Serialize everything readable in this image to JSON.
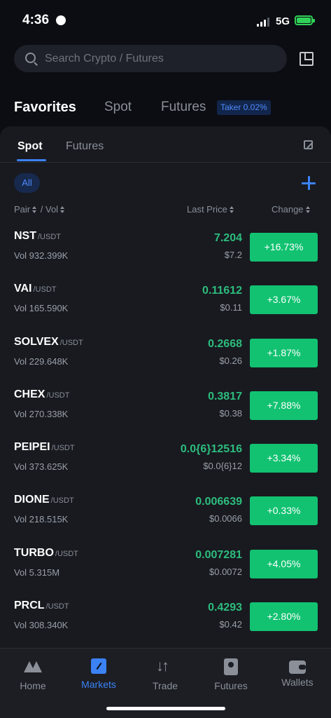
{
  "status_bar": {
    "time": "4:36",
    "network": "5G"
  },
  "search": {
    "placeholder": "Search Crypto / Futures"
  },
  "top_tabs": [
    {
      "label": "Favorites",
      "active": true
    },
    {
      "label": "Spot",
      "active": false
    },
    {
      "label": "Futures",
      "active": false
    }
  ],
  "taker_badge": "Taker 0.02%",
  "sub_tabs": [
    {
      "label": "Spot",
      "active": true
    },
    {
      "label": "Futures",
      "active": false
    }
  ],
  "filter": {
    "label": "All"
  },
  "columns": {
    "pair": "Pair",
    "vol": "Vol",
    "last_price": "Last Price",
    "change": "Change"
  },
  "rows": [
    {
      "base": "NST",
      "quote": "/USDT",
      "vol": "Vol 932.399K",
      "price": "7.204",
      "fiat": "$7.2",
      "change": "+16.73%"
    },
    {
      "base": "VAI",
      "quote": "/USDT",
      "vol": "Vol 165.590K",
      "price": "0.11612",
      "fiat": "$0.11",
      "change": "+3.67%"
    },
    {
      "base": "SOLVEX",
      "quote": "/USDT",
      "vol": "Vol 229.648K",
      "price": "0.2668",
      "fiat": "$0.26",
      "change": "+1.87%"
    },
    {
      "base": "CHEX",
      "quote": "/USDT",
      "vol": "Vol 270.338K",
      "price": "0.3817",
      "fiat": "$0.38",
      "change": "+7.88%"
    },
    {
      "base": "PEIPEI",
      "quote": "/USDT",
      "vol": "Vol 373.625K",
      "price": "0.0{6}12516",
      "fiat": "$0.0{6}12",
      "change": "+3.34%"
    },
    {
      "base": "DIONE",
      "quote": "/USDT",
      "vol": "Vol 218.515K",
      "price": "0.006639",
      "fiat": "$0.0066",
      "change": "+0.33%"
    },
    {
      "base": "TURBO",
      "quote": "/USDT",
      "vol": "Vol 5.315M",
      "price": "0.007281",
      "fiat": "$0.0072",
      "change": "+4.05%"
    },
    {
      "base": "PRCL",
      "quote": "/USDT",
      "vol": "Vol 308.340K",
      "price": "0.4293",
      "fiat": "$0.42",
      "change": "+2.80%"
    }
  ],
  "bottom_nav": [
    {
      "label": "Home",
      "icon": "home-icon",
      "active": false
    },
    {
      "label": "Markets",
      "icon": "markets-icon",
      "active": true
    },
    {
      "label": "Trade",
      "icon": "trade-icon",
      "active": false
    },
    {
      "label": "Futures",
      "icon": "futures-icon",
      "active": false
    },
    {
      "label": "Wallets",
      "icon": "wallet-icon",
      "active": false
    }
  ],
  "colors": {
    "accent": "#3b82f6",
    "positive": "#2dbd7d",
    "change_badge": "#12c271",
    "background": "#0b0d12",
    "panel": "#181a20"
  }
}
